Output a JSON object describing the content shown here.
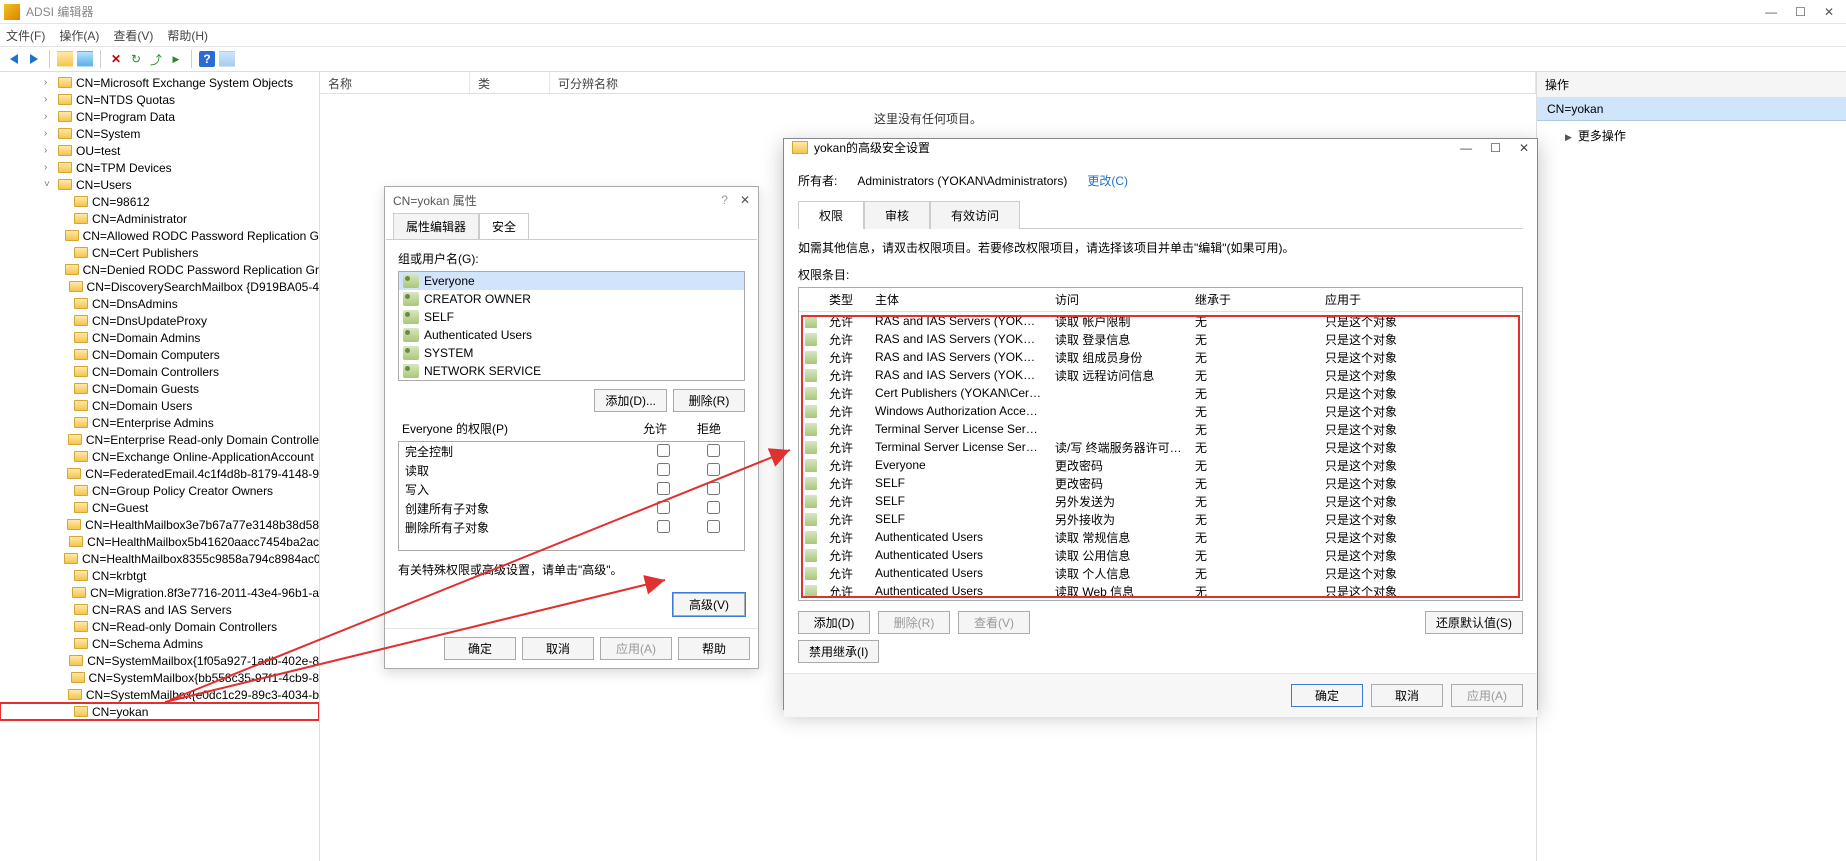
{
  "app": {
    "title": "ADSI 编辑器"
  },
  "menu": {
    "file": "文件(F)",
    "action": "操作(A)",
    "view": "查看(V)",
    "help": "帮助(H)"
  },
  "list": {
    "cols": {
      "name": "名称",
      "class": "类",
      "dn": "可分辨名称"
    },
    "empty": "这里没有任何项目。"
  },
  "actions": {
    "title": "操作",
    "selected": "CN=yokan",
    "more": "更多操作"
  },
  "tree": {
    "root_items": [
      "CN=Microsoft Exchange System Objects",
      "CN=NTDS Quotas",
      "CN=Program Data",
      "CN=System",
      "OU=test",
      "CN=TPM Devices"
    ],
    "users_label": "CN=Users",
    "users": [
      "CN=98612",
      "CN=Administrator",
      "CN=Allowed RODC Password Replication G",
      "CN=Cert Publishers",
      "CN=Denied RODC Password Replication Gr",
      "CN=DiscoverySearchMailbox {D919BA05-4",
      "CN=DnsAdmins",
      "CN=DnsUpdateProxy",
      "CN=Domain Admins",
      "CN=Domain Computers",
      "CN=Domain Controllers",
      "CN=Domain Guests",
      "CN=Domain Users",
      "CN=Enterprise Admins",
      "CN=Enterprise Read-only Domain Controlle",
      "CN=Exchange Online-ApplicationAccount",
      "CN=FederatedEmail.4c1f4d8b-8179-4148-9",
      "CN=Group Policy Creator Owners",
      "CN=Guest",
      "CN=HealthMailbox3e7b67a77e3148b38d58",
      "CN=HealthMailbox5b41620aacc7454ba2ac",
      "CN=HealthMailbox8355c9858a794c8984ac0",
      "CN=krbtgt",
      "CN=Migration.8f3e7716-2011-43e4-96b1-a",
      "CN=RAS and IAS Servers",
      "CN=Read-only Domain Controllers",
      "CN=Schema Admins",
      "CN=SystemMailbox{1f05a927-1adb-402e-8",
      "CN=SystemMailbox{bb558c35-97f1-4cb9-8",
      "CN=SystemMailbox{e0dc1c29-89c3-4034-b",
      "CN=yokan"
    ]
  },
  "props": {
    "title": "CN=yokan 属性",
    "tab_attr": "属性编辑器",
    "tab_sec": "安全",
    "groups_label": "组或用户名(G):",
    "groups": [
      "Everyone",
      "CREATOR OWNER",
      "SELF",
      "Authenticated Users",
      "SYSTEM",
      "NETWORK SERVICE"
    ],
    "btn_add": "添加(D)...",
    "btn_remove": "删除(R)",
    "perm_label_prefix": "Everyone 的权限(P)",
    "col_allow": "允许",
    "col_deny": "拒绝",
    "perms": [
      "完全控制",
      "读取",
      "写入",
      "创建所有子对象",
      "删除所有子对象"
    ],
    "note": "有关特殊权限或高级设置，请单击\"高级\"。",
    "btn_adv": "高级(V)",
    "btn_ok": "确定",
    "btn_cancel": "取消",
    "btn_apply": "应用(A)",
    "btn_help": "帮助"
  },
  "adv": {
    "title": "yokan的高级安全设置",
    "owner_label": "所有者:",
    "owner_value": "Administrators (YOKAN\\Administrators)",
    "owner_change": "更改(C)",
    "tab_perm": "权限",
    "tab_audit": "审核",
    "tab_eff": "有效访问",
    "hint": "如需其他信息，请双击权限项目。若要修改权限项目，请选择该项目并单击\"编辑\"(如果可用)。",
    "entries_label": "权限条目:",
    "cols": {
      "type": "类型",
      "principal": "主体",
      "access": "访问",
      "inherit": "继承于",
      "apply": "应用于"
    },
    "rows": [
      {
        "type": "允许",
        "principal": "RAS and IAS Servers (YOKAN\\R...",
        "access": "读取 帐户限制",
        "inherit": "无",
        "apply": "只是这个对象"
      },
      {
        "type": "允许",
        "principal": "RAS and IAS Servers (YOKAN\\R...",
        "access": "读取 登录信息",
        "inherit": "无",
        "apply": "只是这个对象"
      },
      {
        "type": "允许",
        "principal": "RAS and IAS Servers (YOKAN\\R...",
        "access": "读取 组成员身份",
        "inherit": "无",
        "apply": "只是这个对象"
      },
      {
        "type": "允许",
        "principal": "RAS and IAS Servers (YOKAN\\R...",
        "access": "读取 远程访问信息",
        "inherit": "无",
        "apply": "只是这个对象"
      },
      {
        "type": "允许",
        "principal": "Cert Publishers (YOKAN\\Cert Pu...",
        "access": "",
        "inherit": "无",
        "apply": "只是这个对象"
      },
      {
        "type": "允许",
        "principal": "Windows Authorization Access ...",
        "access": "",
        "inherit": "无",
        "apply": "只是这个对象"
      },
      {
        "type": "允许",
        "principal": "Terminal Server License Servers...",
        "access": "",
        "inherit": "无",
        "apply": "只是这个对象"
      },
      {
        "type": "允许",
        "principal": "Terminal Server License Servers...",
        "access": "读/写 终端服务器许可证服...",
        "inherit": "无",
        "apply": "只是这个对象"
      },
      {
        "type": "允许",
        "principal": "Everyone",
        "access": "更改密码",
        "inherit": "无",
        "apply": "只是这个对象"
      },
      {
        "type": "允许",
        "principal": "SELF",
        "access": "更改密码",
        "inherit": "无",
        "apply": "只是这个对象"
      },
      {
        "type": "允许",
        "principal": "SELF",
        "access": "另外发送为",
        "inherit": "无",
        "apply": "只是这个对象"
      },
      {
        "type": "允许",
        "principal": "SELF",
        "access": "另外接收为",
        "inherit": "无",
        "apply": "只是这个对象"
      },
      {
        "type": "允许",
        "principal": "Authenticated Users",
        "access": "读取 常规信息",
        "inherit": "无",
        "apply": "只是这个对象"
      },
      {
        "type": "允许",
        "principal": "Authenticated Users",
        "access": "读取 公用信息",
        "inherit": "无",
        "apply": "只是这个对象"
      },
      {
        "type": "允许",
        "principal": "Authenticated Users",
        "access": "读取 个人信息",
        "inherit": "无",
        "apply": "只是这个对象"
      },
      {
        "type": "允许",
        "principal": "Authenticated Users",
        "access": "读取 Web 信息",
        "inherit": "无",
        "apply": "只是这个对象"
      }
    ],
    "btn_add": "添加(D)",
    "btn_remove": "删除(R)",
    "btn_view": "查看(V)",
    "btn_restore": "还原默认值(S)",
    "btn_disinh": "禁用继承(I)",
    "btn_ok": "确定",
    "btn_cancel": "取消",
    "btn_apply": "应用(A)"
  }
}
